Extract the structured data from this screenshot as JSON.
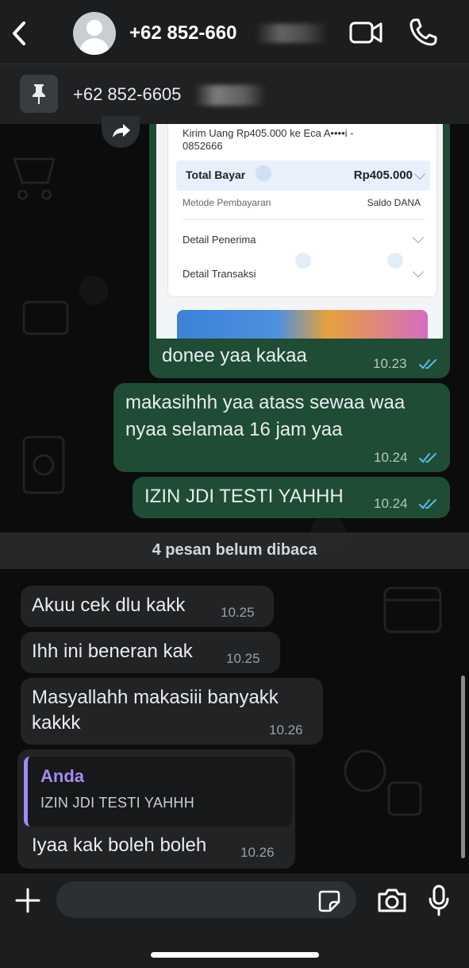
{
  "header": {
    "contact_name": "+62 852-660",
    "icons": [
      "back-icon",
      "avatar",
      "video-call-icon",
      "voice-call-icon"
    ]
  },
  "pinned": {
    "text": "+62 852-6605"
  },
  "receipt": {
    "line1": "Kirim Uang Rp405.000 ke Eca A••••i -",
    "line2": "0852666",
    "total_label": "Total Bayar",
    "total_value": "Rp405.000",
    "metode_label": "Metode Pembayaran",
    "metode_value": "Saldo DANA",
    "detail_penerima": "Detail Penerima",
    "detail_transaksi": "Detail Transaksi"
  },
  "messages_out": [
    {
      "text": "donee yaa kakaa",
      "time": "10.23",
      "status": "read"
    },
    {
      "line1": "makasihhh yaa atass sewaa waa",
      "line2": "nyaa selamaa  16 jam yaa",
      "time": "10.24",
      "status": "read"
    },
    {
      "text": "IZIN JDI TESTI YAHHH",
      "time": "10.24",
      "status": "read"
    }
  ],
  "unread_banner": "4 pesan belum dibaca",
  "messages_in": [
    {
      "text": "Akuu cek dlu kakk",
      "time": "10.25"
    },
    {
      "text": "Ihh ini beneran kak",
      "time": "10.25"
    },
    {
      "line1": "Masyallahh makasiii banyakk",
      "line2": "kakkk",
      "time": "10.26"
    },
    {
      "quote_name": "Anda",
      "quote_text": "IZIN JDI TESTI YAHHH",
      "text": "Iyaa kak boleh boleh",
      "time": "10.26"
    }
  ],
  "input": {
    "placeholder": ""
  },
  "colors": {
    "outgoing_bubble": "#1f4c35",
    "incoming_bubble": "#212325",
    "read_ticks": "#53bdeb",
    "quote_accent": "#a58af2"
  }
}
